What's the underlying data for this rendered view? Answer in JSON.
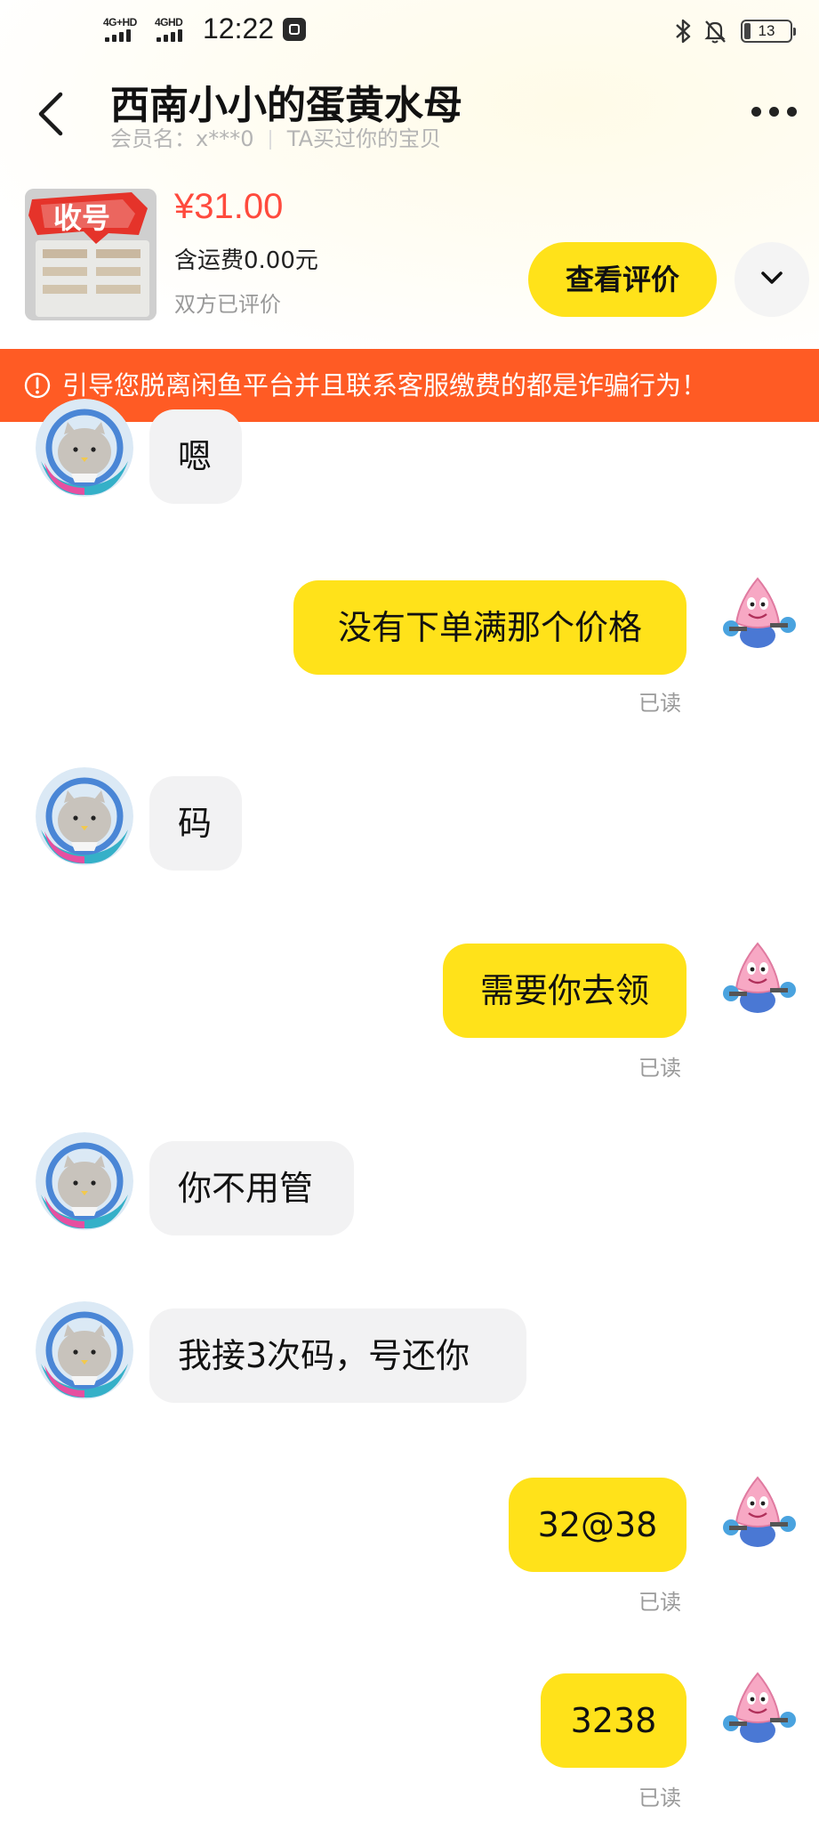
{
  "status_bar": {
    "net1": "4G+HD",
    "net2": "4GHD",
    "time": "12:22",
    "battery": "13"
  },
  "header": {
    "title": "西南小小的蛋黄水母",
    "member_label": "会员名：x***0",
    "relation_note": "TA买过你的宝贝"
  },
  "product": {
    "thumb_text": "收号",
    "price": "¥31.00",
    "shipping": "含运费0.00元",
    "status": "双方已评价",
    "view_review_button": "查看评价"
  },
  "warning": {
    "text": "引导您脱离闲鱼平台并且联系客服缴费的都是诈骗行为！"
  },
  "messages": [
    {
      "side": "left",
      "text": "嗯"
    },
    {
      "side": "right",
      "text": "没有下单满那个价格",
      "status": "已读"
    },
    {
      "side": "left",
      "text": "码"
    },
    {
      "side": "right",
      "text": "需要你去领",
      "status": "已读"
    },
    {
      "side": "left",
      "text": "你不用管"
    },
    {
      "side": "left",
      "text": "我接3次码，号还你"
    },
    {
      "side": "right",
      "text": "32@38",
      "status": "已读"
    },
    {
      "side": "right",
      "text": "3238",
      "status": "已读"
    }
  ]
}
